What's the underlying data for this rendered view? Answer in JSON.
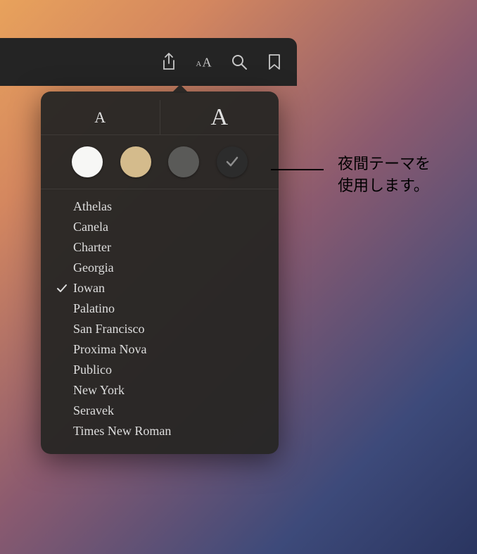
{
  "toolbar": {
    "icons": [
      "share-icon",
      "appearance-icon",
      "search-icon",
      "bookmark-icon"
    ]
  },
  "popover": {
    "fontSize": {
      "smallLabel": "A",
      "largeLabel": "A"
    },
    "themes": [
      {
        "name": "white",
        "color": "#f7f7f5",
        "selected": false
      },
      {
        "name": "sepia",
        "color": "#d4bb8c",
        "selected": false
      },
      {
        "name": "gray",
        "color": "#5a5a58",
        "selected": false
      },
      {
        "name": "night",
        "color": "#2c2c2c",
        "selected": true
      }
    ],
    "fonts": [
      {
        "name": "Athelas",
        "selected": false
      },
      {
        "name": "Canela",
        "selected": false
      },
      {
        "name": "Charter",
        "selected": false
      },
      {
        "name": "Georgia",
        "selected": false
      },
      {
        "name": "Iowan",
        "selected": true
      },
      {
        "name": "Palatino",
        "selected": false
      },
      {
        "name": "San Francisco",
        "selected": false
      },
      {
        "name": "Proxima Nova",
        "selected": false
      },
      {
        "name": "Publico",
        "selected": false
      },
      {
        "name": "New York",
        "selected": false
      },
      {
        "name": "Seravek",
        "selected": false
      },
      {
        "name": "Times New Roman",
        "selected": false
      }
    ]
  },
  "callout": {
    "line1": "夜間テーマを",
    "line2": "使用します。"
  }
}
